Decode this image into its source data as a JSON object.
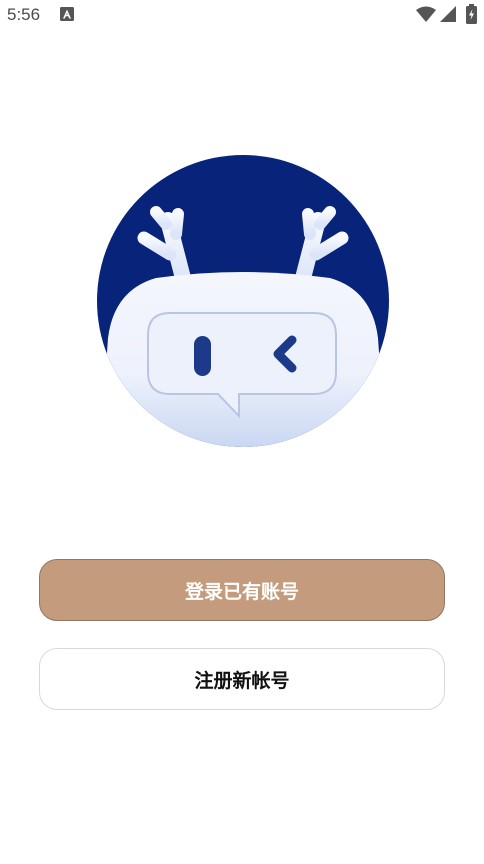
{
  "status_bar": {
    "time": "5:56",
    "icons": [
      "notification-a-icon",
      "wifi-icon",
      "signal-icon",
      "battery-charging-icon"
    ]
  },
  "logo": {
    "icon": "robot-deer-logo",
    "colors": {
      "circle": "#07237a",
      "face": "#eef3fd",
      "accent": "#1d3a8a"
    }
  },
  "actions": {
    "login_label": "登录已有账号",
    "register_label": "注册新帐号"
  },
  "colors": {
    "login_button": "#c49b7d",
    "register_button": "#ffffff"
  }
}
